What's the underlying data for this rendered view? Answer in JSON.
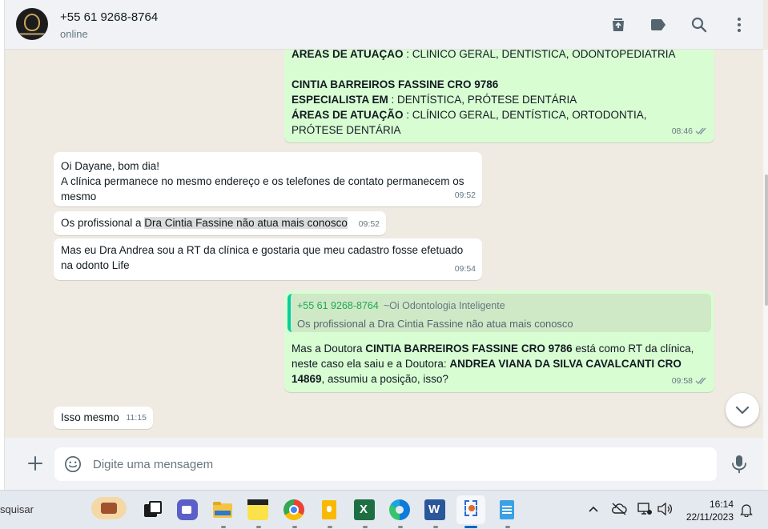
{
  "header": {
    "contact_name": "+55 61 9268-8764",
    "status": "online",
    "icons": [
      "archive-icon",
      "label-icon",
      "search-icon",
      "menu-icon"
    ]
  },
  "messages": {
    "m1": {
      "line1_label": "ÁREAS DE ATUAÇÃO",
      "line1_text": " : CLÍNICO GERAL, DENTÍSTICA, ODONTOPEDIATRIA",
      "line2": "CINTIA BARREIROS FASSINE  CRO 9786",
      "line3_label": "ESPECIALISTA EM",
      "line3_text": " : DENTÍSTICA, PRÓTESE DENTÁRIA",
      "line4_label": "ÁREAS DE ATUAÇÃO",
      "line4_text": " : CLÍNICO GERAL, DENTÍSTICA, ORTODONTIA, PRÓTESE DENTÁRIA",
      "time": "08:46"
    },
    "m2": {
      "text": "Oi Dayane, bom dia!\nA clínica permanece no mesmo endereço e os telefones de contato permanecem os mesmo",
      "time": "09:52"
    },
    "m3": {
      "text_pre": "Os profissional a ",
      "text_hl": "Dra Cintia Fassine não atua mais conosco",
      "time": "09:52"
    },
    "m4": {
      "text": "Mas eu Dra Andrea sou a RT da clínica e gostaria que meu cadastro fosse efetuado na odonto Life",
      "time": "09:54"
    },
    "m5": {
      "quote_author": "+55 61 9268-8764",
      "quote_sender": "~Oi Odontologia Inteligente",
      "quote_text": "Os profissional a Dra Cintia Fassine não atua mais conosco",
      "t1": "Mas a Doutora ",
      "b1": "CINTIA BARREIROS FASSINE  CRO 9786",
      "t2": " está como RT da clínica, neste caso ela saiu e a Doutora: ",
      "b2": "ANDREA VIANA DA SILVA CAVALCANTI  CRO 14869",
      "t3": ", assumiu a posição, isso?",
      "time": "09:58"
    },
    "m6": {
      "text": "Isso mesmo",
      "time": "11:15"
    }
  },
  "compose": {
    "placeholder": "Digite uma mensagem"
  },
  "taskbar": {
    "search_text": "squisar",
    "time": "16:14",
    "date": "22/11/2023"
  },
  "colors": {
    "outgoing_bubble": "#d9fdd3",
    "incoming_bubble": "#ffffff",
    "chat_background": "#efeae2",
    "quote_author": "#1fa855",
    "read_ticks": "#8696a0"
  }
}
